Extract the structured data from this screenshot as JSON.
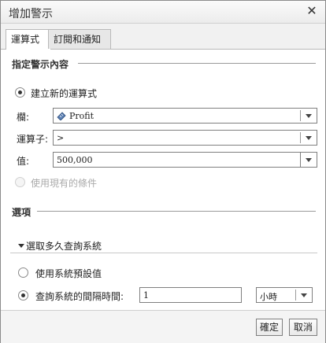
{
  "dialog": {
    "title": "增加警示",
    "close_glyph": "✕"
  },
  "tabs": [
    {
      "label": "運算式",
      "active": true
    },
    {
      "label": "訂閱和通知",
      "active": false
    }
  ],
  "section_content": {
    "heading": "指定警示內容",
    "create_new_label": "建立新的運算式",
    "column_label": "欄:",
    "column_value": "Profit",
    "operator_label": "運算子:",
    "operator_value": ">",
    "value_label": "值:",
    "value_value": "500,000",
    "use_existing_label": "使用現有的條件"
  },
  "section_options": {
    "heading": "選項",
    "frequency_label": "選取多久查詢系統",
    "use_default_label": "使用系統預設值",
    "interval_label": "查詢系統的間隔時間:",
    "interval_value": "1",
    "unit_value": "小時"
  },
  "footer": {
    "ok_label": "確定",
    "cancel_label": "取消"
  },
  "colors": {
    "border": "#7f7f7f",
    "section_line": "#9a9a9a",
    "footer_bg": "#f4f4f4"
  }
}
